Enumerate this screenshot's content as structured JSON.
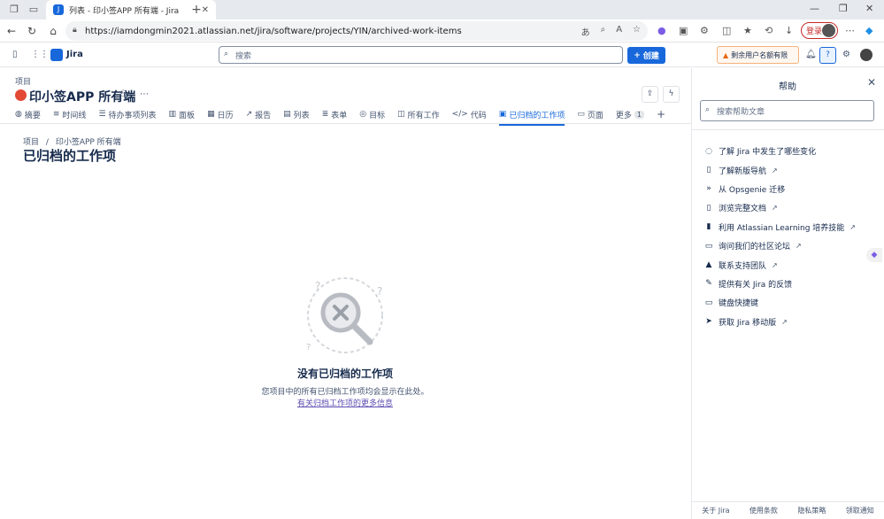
{
  "browser": {
    "tab_title": "列表 - 印小签APP 所有端 - Jira",
    "url": "https://iamdongmin2021.atlassian.net/jira/software/projects/YIN/archived-work-items",
    "login_label": "登录"
  },
  "jira": {
    "app_name": "Jira",
    "search_placeholder": "搜索",
    "create_label": "创建",
    "warning_label": "剩余用户名额有限"
  },
  "project": {
    "space_label": "项目",
    "name": "印小签APP 所有端",
    "tabs": [
      {
        "label": "摘要",
        "icon": "globe-icon"
      },
      {
        "label": "时间线",
        "icon": "timeline-icon"
      },
      {
        "label": "待办事项列表",
        "icon": "backlog-icon"
      },
      {
        "label": "面板",
        "icon": "board-icon"
      },
      {
        "label": "日历",
        "icon": "calendar-icon"
      },
      {
        "label": "报告",
        "icon": "chart-icon"
      },
      {
        "label": "列表",
        "icon": "list-icon"
      },
      {
        "label": "表单",
        "icon": "form-icon"
      },
      {
        "label": "目标",
        "icon": "target-icon"
      },
      {
        "label": "所有工作",
        "icon": "all-work-icon"
      },
      {
        "label": "代码",
        "icon": "code-icon"
      },
      {
        "label": "已归档的工作项",
        "icon": "archive-icon",
        "active": true
      },
      {
        "label": "页面",
        "icon": "page-icon"
      }
    ],
    "more_label": "更多",
    "more_count": "1"
  },
  "page": {
    "breadcrumb_root": "项目",
    "breadcrumb_sep": "/",
    "breadcrumb_project": "印小签APP 所有端",
    "title": "已归档的工作项",
    "empty_title": "没有已归档的工作项",
    "empty_desc": "您项目中的所有已归档工作项均会显示在此处。",
    "empty_link": "有关归档工作项的更多信息"
  },
  "help": {
    "title": "帮助",
    "search_placeholder": "搜索帮助文章",
    "items": [
      {
        "label": "了解 Jira 中发生了哪些变化",
        "icon": "lightbulb-icon",
        "external": false
      },
      {
        "label": "了解新版导航",
        "icon": "document-icon",
        "external": true
      },
      {
        "label": "从 Opsgenie 迁移",
        "icon": "migrate-icon",
        "external": false
      },
      {
        "label": "浏览完整文档",
        "icon": "document-icon",
        "external": true
      },
      {
        "label": "利用 Atlassian Learning 培养技能",
        "icon": "book-icon",
        "external": true
      },
      {
        "label": "询问我们的社区论坛",
        "icon": "comment-icon",
        "external": true
      },
      {
        "label": "联系支持团队",
        "icon": "warning-icon",
        "external": true
      },
      {
        "label": "提供有关 Jira 的反馈",
        "icon": "feedback-icon",
        "external": false
      },
      {
        "label": "键盘快捷键",
        "icon": "keyboard-icon",
        "external": false
      },
      {
        "label": "获取 Jira 移动版",
        "icon": "send-icon",
        "external": true
      }
    ],
    "footer": [
      "关于 Jira",
      "使用条款",
      "隐私策略",
      "领取通知"
    ]
  }
}
